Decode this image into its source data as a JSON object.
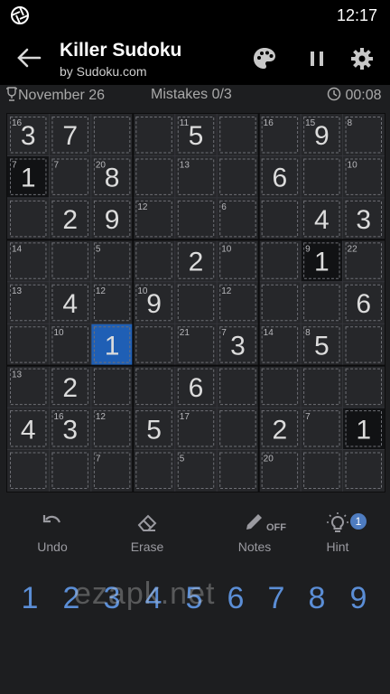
{
  "status_bar": {
    "time": "12:17",
    "camera_icon": "aperture-icon"
  },
  "app_bar": {
    "title": "Killer Sudoku",
    "subtitle": "by Sudoku.com",
    "icons": [
      "back-arrow-icon",
      "palette-icon",
      "pause-icon",
      "gear-icon"
    ]
  },
  "info": {
    "date": "November 26",
    "mistakes": "Mistakes 0/3",
    "timer": "00:08",
    "icons": [
      "trophy-icon",
      "clock-icon"
    ]
  },
  "board": {
    "digits": [
      [
        3,
        7,
        0,
        0,
        5,
        0,
        0,
        9,
        0
      ],
      [
        1,
        0,
        8,
        0,
        0,
        0,
        6,
        0,
        0
      ],
      [
        0,
        2,
        9,
        0,
        0,
        0,
        0,
        4,
        3
      ],
      [
        0,
        0,
        0,
        0,
        2,
        0,
        0,
        1,
        0
      ],
      [
        0,
        4,
        0,
        9,
        0,
        0,
        0,
        0,
        6
      ],
      [
        0,
        0,
        1,
        0,
        0,
        3,
        0,
        5,
        0
      ],
      [
        0,
        2,
        0,
        0,
        6,
        0,
        0,
        0,
        0
      ],
      [
        4,
        3,
        0,
        5,
        0,
        0,
        2,
        0,
        1
      ],
      [
        0,
        0,
        0,
        0,
        0,
        0,
        0,
        0,
        0
      ]
    ],
    "cage_sums": [
      {
        "row": 0,
        "col": 0,
        "sum": "16"
      },
      {
        "row": 0,
        "col": 4,
        "sum": "11"
      },
      {
        "row": 0,
        "col": 6,
        "sum": "16"
      },
      {
        "row": 0,
        "col": 7,
        "sum": "15"
      },
      {
        "row": 0,
        "col": 8,
        "sum": "8"
      },
      {
        "row": 1,
        "col": 0,
        "sum": "7"
      },
      {
        "row": 1,
        "col": 1,
        "sum": "7"
      },
      {
        "row": 1,
        "col": 2,
        "sum": "20"
      },
      {
        "row": 1,
        "col": 4,
        "sum": "13"
      },
      {
        "row": 1,
        "col": 8,
        "sum": "10"
      },
      {
        "row": 2,
        "col": 3,
        "sum": "12"
      },
      {
        "row": 2,
        "col": 5,
        "sum": "6"
      },
      {
        "row": 3,
        "col": 0,
        "sum": "14"
      },
      {
        "row": 3,
        "col": 2,
        "sum": "5"
      },
      {
        "row": 3,
        "col": 5,
        "sum": "10"
      },
      {
        "row": 3,
        "col": 7,
        "sum": "9"
      },
      {
        "row": 3,
        "col": 8,
        "sum": "22"
      },
      {
        "row": 4,
        "col": 0,
        "sum": "13"
      },
      {
        "row": 4,
        "col": 2,
        "sum": "12"
      },
      {
        "row": 4,
        "col": 3,
        "sum": "10"
      },
      {
        "row": 4,
        "col": 5,
        "sum": "12"
      },
      {
        "row": 5,
        "col": 1,
        "sum": "10"
      },
      {
        "row": 5,
        "col": 4,
        "sum": "21"
      },
      {
        "row": 5,
        "col": 5,
        "sum": "7"
      },
      {
        "row": 5,
        "col": 6,
        "sum": "14"
      },
      {
        "row": 5,
        "col": 7,
        "sum": "8"
      },
      {
        "row": 6,
        "col": 0,
        "sum": "13"
      },
      {
        "row": 7,
        "col": 1,
        "sum": "16"
      },
      {
        "row": 7,
        "col": 2,
        "sum": "12"
      },
      {
        "row": 7,
        "col": 4,
        "sum": "17"
      },
      {
        "row": 7,
        "col": 7,
        "sum": "7"
      },
      {
        "row": 8,
        "col": 2,
        "sum": "7"
      },
      {
        "row": 8,
        "col": 4,
        "sum": "5"
      },
      {
        "row": 8,
        "col": 6,
        "sum": "20"
      }
    ],
    "selected_cell": {
      "row": 5,
      "col": 2
    },
    "highlighted_digit": 1
  },
  "tools": {
    "undo": {
      "label": "Undo",
      "icon": "undo-icon"
    },
    "erase": {
      "label": "Erase",
      "icon": "eraser-icon"
    },
    "notes": {
      "label": "Notes",
      "icon": "pencil-icon",
      "state": "OFF"
    },
    "hint": {
      "label": "Hint",
      "icon": "lightbulb-icon",
      "count": "1"
    }
  },
  "numpad": [
    "1",
    "2",
    "3",
    "4",
    "5",
    "6",
    "7",
    "8",
    "9"
  ],
  "watermark": "ezapk.net",
  "colors": {
    "accent": "#5b8ed6",
    "selected_cell": "#1f5fb5",
    "same_digit_cell": "#111214",
    "board_bg": "#26272a"
  }
}
